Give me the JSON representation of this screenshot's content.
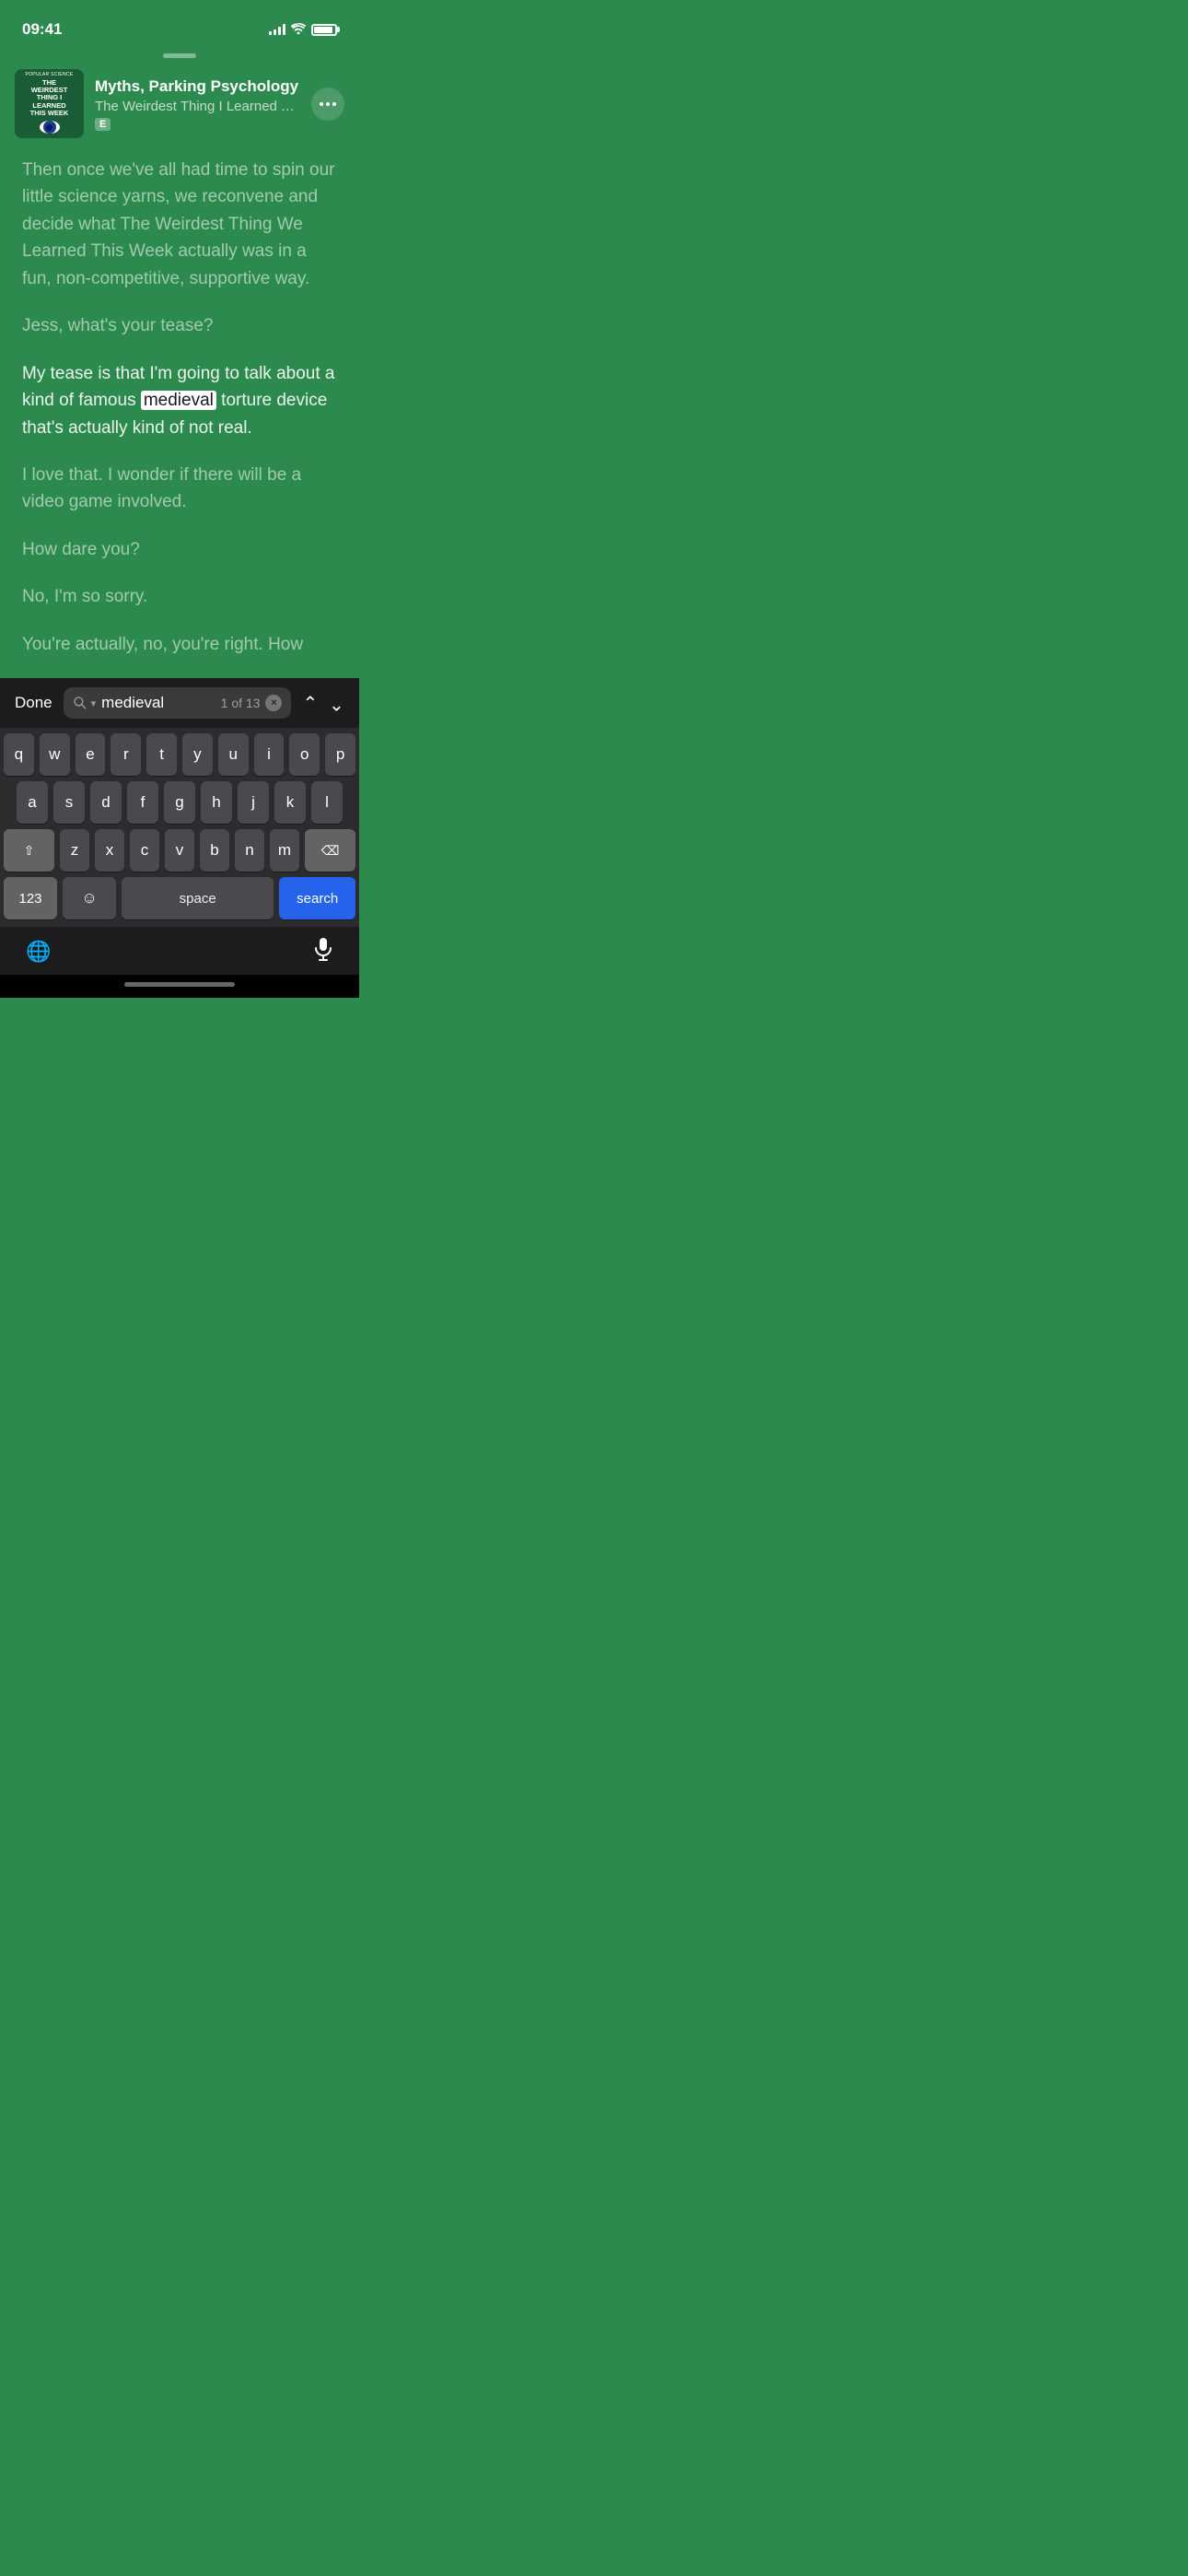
{
  "statusBar": {
    "time": "09:41",
    "battery": "100"
  },
  "podcast": {
    "episodeTitle": "Myths, Parking Psychology",
    "showTitle": "The Weirdest Thing I Learned This We",
    "explicit": "E",
    "artworkTextTop": "POPULAR SCIENCE",
    "artworkTitle": "THE\nWEIRDEST\nTHING I\nLEARNED\nTHIS WEEK",
    "moreButtonLabel": "..."
  },
  "transcript": {
    "paragraph1": "Then once we've all had time to spin our little science yarns, we reconvene and decide what The Weirdest Thing We Learned This Week actually was in a fun, non-competitive, supportive way.",
    "paragraph2": "Jess, what's your tease?",
    "paragraph3_pre": "My tease is that I'm going to talk about a kind of famous ",
    "paragraph3_highlight": "medieval",
    "paragraph3_post": " torture device that's actually kind of not real.",
    "paragraph4": "I love that. I wonder if there will be a video game involved.",
    "paragraph5": "How dare you?",
    "paragraph6": "No, I'm so sorry.",
    "paragraph7": "You're actually, no, you're right. How"
  },
  "searchBar": {
    "doneLabel": "Done",
    "searchText": "medieval",
    "countText": "1 of 13",
    "clearIcon": "×"
  },
  "keyboard": {
    "row1": [
      "q",
      "w",
      "e",
      "r",
      "t",
      "y",
      "u",
      "i",
      "o",
      "p"
    ],
    "row2": [
      "a",
      "s",
      "d",
      "f",
      "g",
      "h",
      "j",
      "k",
      "l"
    ],
    "row3": [
      "z",
      "x",
      "c",
      "v",
      "b",
      "n",
      "m"
    ],
    "spaceLabel": "space",
    "searchLabel": "search",
    "numbersLabel": "123"
  }
}
